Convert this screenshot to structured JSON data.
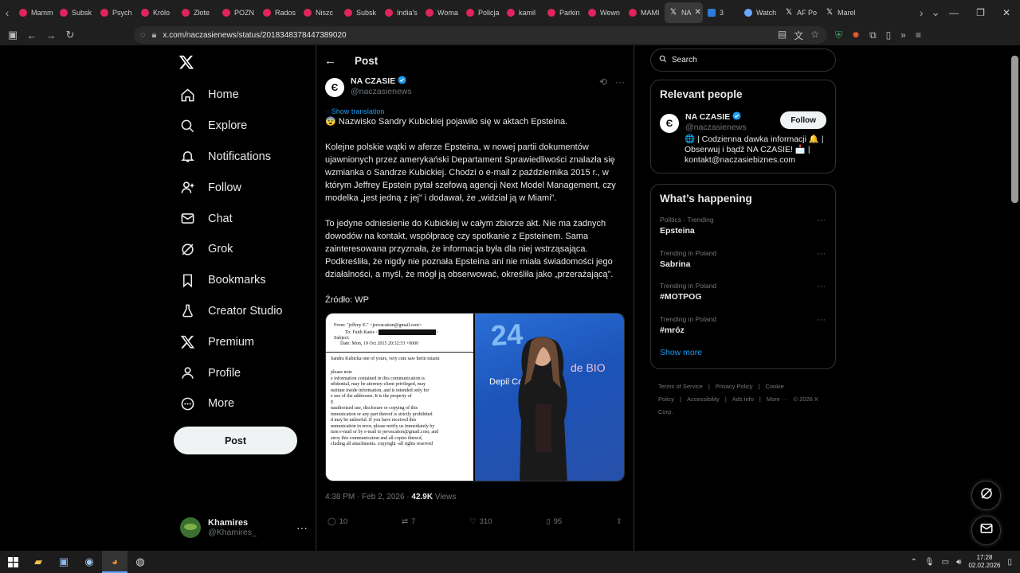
{
  "browser": {
    "tabs": [
      {
        "label": "Mamm",
        "icon": "youtube-icon"
      },
      {
        "label": "Subsk",
        "icon": "youtube-icon"
      },
      {
        "label": "Psych",
        "icon": "youtube-icon"
      },
      {
        "label": "Królo",
        "icon": "youtube-icon"
      },
      {
        "label": "Złote",
        "icon": "youtube-icon"
      },
      {
        "label": "POZN",
        "icon": "youtube-icon"
      },
      {
        "label": "Rados",
        "icon": "youtube-icon"
      },
      {
        "label": "Niszc",
        "icon": "youtube-icon"
      },
      {
        "label": "Subsk",
        "icon": "youtube-icon"
      },
      {
        "label": "India's",
        "icon": "youtube-icon"
      },
      {
        "label": "Woma",
        "icon": "youtube-icon"
      },
      {
        "label": "Policja",
        "icon": "youtube-icon"
      },
      {
        "label": "kamil",
        "icon": "youtube-icon"
      },
      {
        "label": "Parkin",
        "icon": "youtube-icon"
      },
      {
        "label": "Wewn",
        "icon": "youtube-icon"
      },
      {
        "label": "MAMI",
        "icon": "youtube-icon"
      },
      {
        "label": "NA",
        "icon": "x-icon",
        "active": true
      },
      {
        "label": "3",
        "icon": "blue-icon"
      },
      {
        "label": "Watch",
        "icon": "web-icon"
      },
      {
        "label": "AF Po",
        "icon": "x-icon"
      },
      {
        "label": "Marel",
        "icon": "x-icon"
      }
    ],
    "url": "x.com/naczasienews/status/2018348378447389020"
  },
  "sidebar": {
    "items": [
      {
        "label": "Home",
        "icon": "home-icon"
      },
      {
        "label": "Explore",
        "icon": "search-icon"
      },
      {
        "label": "Notifications",
        "icon": "bell-icon"
      },
      {
        "label": "Follow",
        "icon": "add-user-icon"
      },
      {
        "label": "Chat",
        "icon": "mail-icon"
      },
      {
        "label": "Grok",
        "icon": "grok-icon"
      },
      {
        "label": "Bookmarks",
        "icon": "bookmark-icon"
      },
      {
        "label": "Creator Studio",
        "icon": "flask-icon"
      },
      {
        "label": "Premium",
        "icon": "x-logo-icon"
      },
      {
        "label": "Profile",
        "icon": "person-icon"
      },
      {
        "label": "More",
        "icon": "more-circle-icon"
      }
    ],
    "post_label": "Post",
    "account": {
      "name": "Khamires",
      "handle": "@Khamires_"
    }
  },
  "post": {
    "header_title": "Post",
    "author_name": "NA CZASIE",
    "author_handle": "@naczasienews",
    "show_translation": "Show translation",
    "paragraphs": [
      "😨 Nazwisko Sandry Kubickiej pojawiło się w aktach Epsteina.",
      "Kolejne polskie wątki w aferze Epsteina, w nowej partii dokumentów ujawnionych przez amerykański Departament Sprawiedliwości znalazła się wzmianka o Sandrze Kubickiej. Chodzi o e-mail z października 2015 r., w którym Jeffrey Epstein pytał szefową agencji Next Model Management, czy modelka „jest jedną z jej” i dodawał, że „widział ją w Miami”.",
      "To jedyne odniesienie do Kubickiej w całym zbiorze akt. Nie ma żadnych dowodów na kontakt, współpracę czy spotkanie z Epsteinem. Sama zainteresowana przyznała, że informacja była dla niej wstrząsająca. Podkreśliła, że nigdy nie poznała Epsteina ani nie miała świadomości jego działalności, a myśl, że mógł ją obserwować, określiła jako „przerażającą”.",
      "Źródło: WP"
    ],
    "doc": {
      "from": "From:  \"jeffrey E.\" <jeevacation@gmail.com>",
      "to_prefix": "To:  Faith Kates <",
      "to_suffix": ">",
      "subject": "Subject:",
      "date": "Date:  Mon, 19 Oct 2015 20:32:53 +0000",
      "body_line": "Sandra Kubicka  one of yours,  very cute  saw herin miami",
      "notice": [
        "please note",
        "e information contained in this communication is",
        "nfidential, may be attorney-client privileged, may",
        "nstitute inside information, and is intended only for",
        "e use of the addressee. It is the property of",
        "E",
        "nauthorized use, disclosure or copying of this",
        "mmunication or any part thereof is strictly prohibited",
        "d may be unlawful. If you have received this",
        "mmunication in error, please notify us immediately by",
        "turn e-mail or by e-mail to jeevacation@gmail.com, and",
        "stroy this communication and all copies thereof,",
        "cluding all attachments. copyright -all rights reserved"
      ]
    },
    "photo_text": {
      "big": "24",
      "mid": "de BIO",
      "small": "Depil Conc"
    },
    "time": "4:38 PM · Feb 2, 2026 · ",
    "views_count": "42.9K",
    "views_label": " Views",
    "stats": {
      "replies": "10",
      "reposts": "7",
      "likes": "310",
      "bookmarks": "95"
    }
  },
  "right": {
    "search_placeholder": "Search",
    "relevant_title": "Relevant people",
    "person": {
      "name": "NA CZASIE",
      "handle": "@naczasienews",
      "follow": "Follow",
      "bio": "🌐 | Codzienna dawka informacji 🔔 | Obserwuj i bądź NA CZASIE! 📩 | kontakt@naczasiebiznes.com"
    },
    "happening_title": "What’s happening",
    "trends": [
      {
        "cat": "Politics · Trending",
        "topic": "Epsteina"
      },
      {
        "cat": "Trending in Poland",
        "topic": "Sabrina"
      },
      {
        "cat": "Trending in Poland",
        "topic": "#MOTPOG"
      },
      {
        "cat": "Trending in Poland",
        "topic": "#mróz"
      }
    ],
    "show_more": "Show more",
    "footer": [
      "Terms of Service",
      "|",
      "Privacy Policy",
      "|",
      "Cookie Policy",
      "|",
      "Accessibility",
      "|",
      "Ads info",
      "|",
      "More ···",
      "© 2026 X Corp."
    ]
  },
  "taskbar": {
    "time": "17:28",
    "date": "02.02.2026"
  },
  "colors": {
    "accent": "#1d9bf0",
    "background": "#000000",
    "muted": "#71767b"
  }
}
